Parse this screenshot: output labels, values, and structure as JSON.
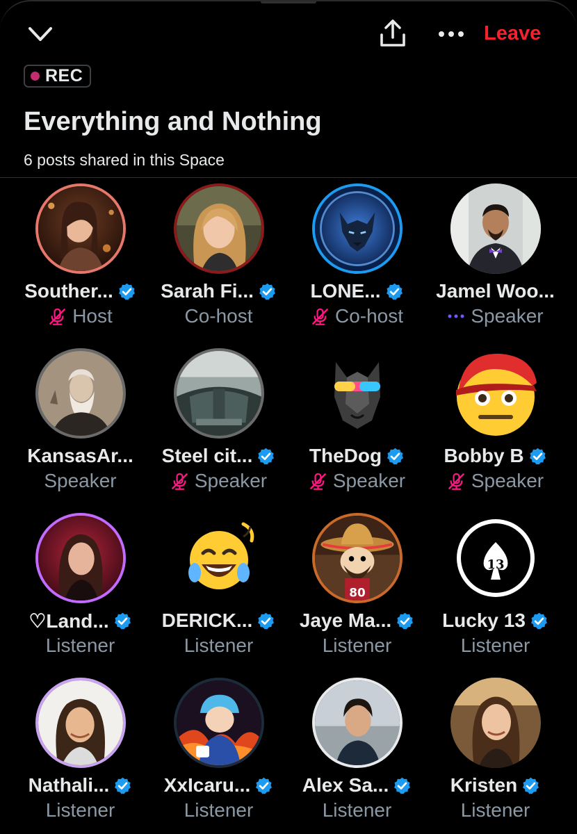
{
  "header": {
    "leave_label": "Leave",
    "rec_label": "REC"
  },
  "space": {
    "title": "Everything and Nothing",
    "subtitle": "6 posts shared in this Space"
  },
  "colors": {
    "accent_blue": "#1d9bf0",
    "leave_red": "#f4212e",
    "muted": "#8b98a5",
    "mic_off": "#f91880",
    "speaking": "#7856ff",
    "rec_dot": "#c12d6f"
  },
  "participants": [
    {
      "name": "Souther...",
      "role": "Host",
      "verified": true,
      "mic": "off"
    },
    {
      "name": "Sarah Fi...",
      "role": "Co-host",
      "verified": true,
      "mic": ""
    },
    {
      "name": "LONE...",
      "role": "Co-host",
      "verified": true,
      "mic": "off"
    },
    {
      "name": "Jamel Woo...",
      "role": "Speaker",
      "verified": false,
      "mic": "speaking"
    },
    {
      "name": "KansasAr...",
      "role": "Speaker",
      "verified": false,
      "mic": ""
    },
    {
      "name": "Steel cit...",
      "role": "Speaker",
      "verified": true,
      "mic": "off"
    },
    {
      "name": "TheDog",
      "role": "Speaker",
      "verified": true,
      "mic": "off"
    },
    {
      "name": "Bobby B",
      "role": "Speaker",
      "verified": true,
      "mic": "off"
    },
    {
      "name": "♡Land...",
      "role": "Listener",
      "verified": true,
      "mic": ""
    },
    {
      "name": "DERICK...",
      "role": "Listener",
      "verified": true,
      "mic": ""
    },
    {
      "name": "Jaye Ma...",
      "role": "Listener",
      "verified": true,
      "mic": ""
    },
    {
      "name": "Lucky 13",
      "role": "Listener",
      "verified": true,
      "mic": ""
    },
    {
      "name": "Nathali...",
      "role": "Listener",
      "verified": true,
      "mic": ""
    },
    {
      "name": "XxIcaru...",
      "role": "Listener",
      "verified": true,
      "mic": ""
    },
    {
      "name": "Alex Sa...",
      "role": "Listener",
      "verified": true,
      "mic": ""
    },
    {
      "name": "Kristen",
      "role": "Listener",
      "verified": true,
      "mic": ""
    }
  ],
  "icons": {
    "collapse": "chevron-down-icon",
    "share": "share-icon",
    "more": "more-options-icon",
    "verified": "verified-badge-icon",
    "mic_off": "mic-off-icon",
    "speaking": "speaking-indicator-icon"
  }
}
